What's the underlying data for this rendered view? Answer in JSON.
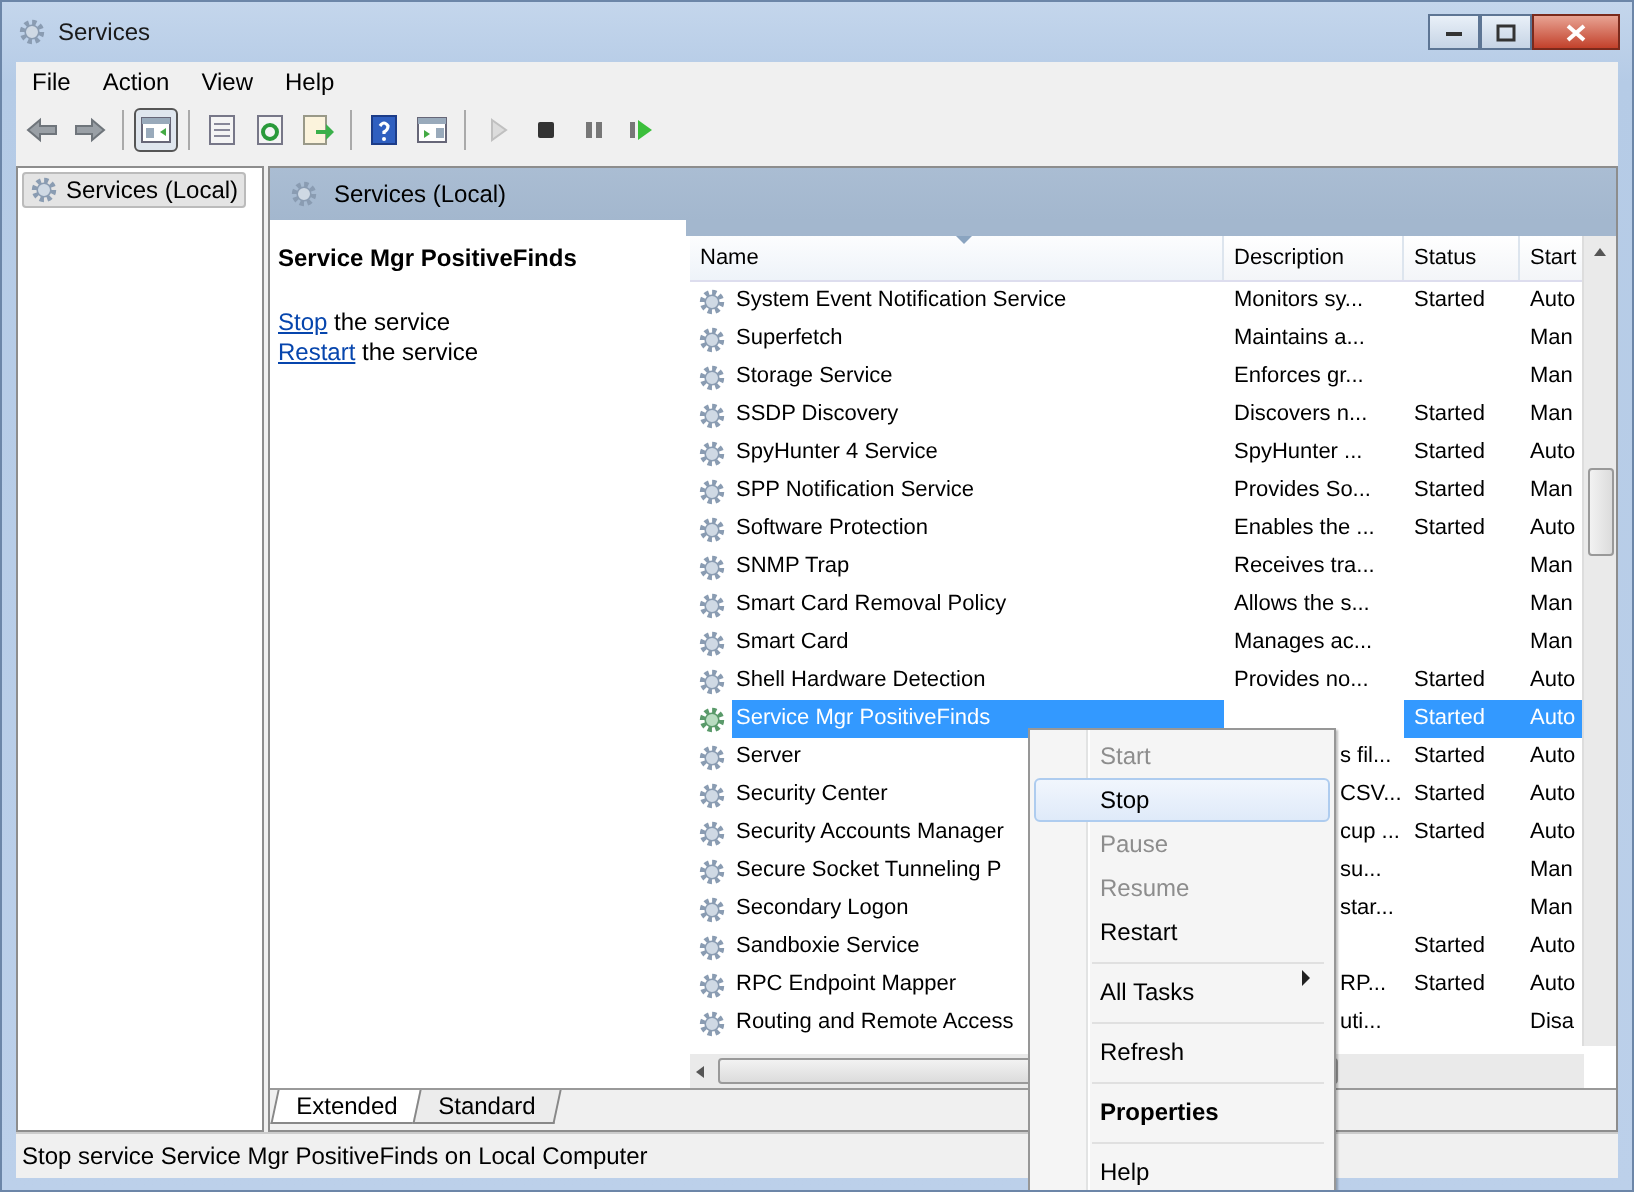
{
  "window": {
    "title": "Services"
  },
  "menu_bar": [
    "File",
    "Action",
    "View",
    "Help"
  ],
  "toolbar": [
    {
      "kind": "back",
      "pressed": false,
      "disabled": false
    },
    {
      "kind": "forward",
      "pressed": false,
      "disabled": false
    },
    {
      "kind": "separator"
    },
    {
      "kind": "console-tree",
      "pressed": true,
      "disabled": false
    },
    {
      "kind": "separator"
    },
    {
      "kind": "properties",
      "pressed": false,
      "disabled": false
    },
    {
      "kind": "refresh",
      "pressed": false,
      "disabled": false
    },
    {
      "kind": "export",
      "pressed": false,
      "disabled": false
    },
    {
      "kind": "separator"
    },
    {
      "kind": "help",
      "pressed": false,
      "disabled": false
    },
    {
      "kind": "action-pane",
      "pressed": false,
      "disabled": false
    },
    {
      "kind": "separator"
    },
    {
      "kind": "start",
      "pressed": false,
      "disabled": true
    },
    {
      "kind": "stop",
      "pressed": false,
      "disabled": false
    },
    {
      "kind": "pause",
      "pressed": false,
      "disabled": false
    },
    {
      "kind": "resume",
      "pressed": false,
      "disabled": false
    }
  ],
  "tree": {
    "items": [
      {
        "label": "Services (Local)",
        "selected": true
      }
    ]
  },
  "pane_header": {
    "title": "Services (Local)"
  },
  "details": {
    "title": "Service Mgr PositiveFinds",
    "actions": [
      {
        "link": "Stop",
        "text": "the service"
      },
      {
        "link": "Restart",
        "text": "the service"
      }
    ]
  },
  "table": {
    "columns": [
      {
        "label": "Name",
        "sorted": true
      },
      {
        "label": "Description",
        "sorted": false
      },
      {
        "label": "Status",
        "sorted": false
      },
      {
        "label": "Start",
        "sorted": false
      }
    ],
    "rows": [
      {
        "name": "System Event Notification Service",
        "description": "Monitors sy...",
        "status": "Started",
        "startup": "Auto",
        "selected": false
      },
      {
        "name": "Superfetch",
        "description": "Maintains a...",
        "status": "",
        "startup": "Man",
        "selected": false
      },
      {
        "name": "Storage Service",
        "description": "Enforces gr...",
        "status": "",
        "startup": "Man",
        "selected": false
      },
      {
        "name": "SSDP Discovery",
        "description": "Discovers n...",
        "status": "Started",
        "startup": "Man",
        "selected": false
      },
      {
        "name": "SpyHunter 4 Service",
        "description": "SpyHunter ...",
        "status": "Started",
        "startup": "Auto",
        "selected": false
      },
      {
        "name": "SPP Notification Service",
        "description": "Provides So...",
        "status": "Started",
        "startup": "Man",
        "selected": false
      },
      {
        "name": "Software Protection",
        "description": "Enables the ...",
        "status": "Started",
        "startup": "Auto",
        "selected": false
      },
      {
        "name": "SNMP Trap",
        "description": "Receives tra...",
        "status": "",
        "startup": "Man",
        "selected": false
      },
      {
        "name": "Smart Card Removal Policy",
        "description": "Allows the s...",
        "status": "",
        "startup": "Man",
        "selected": false
      },
      {
        "name": "Smart Card",
        "description": "Manages ac...",
        "status": "",
        "startup": "Man",
        "selected": false
      },
      {
        "name": "Shell Hardware Detection",
        "description": "Provides no...",
        "status": "Started",
        "startup": "Auto",
        "selected": false
      },
      {
        "name": "Service Mgr PositiveFinds",
        "description": "",
        "status": "Started",
        "startup": "Auto",
        "selected": true
      },
      {
        "name": "Server",
        "description": "s fil...",
        "status": "Started",
        "startup": "Auto",
        "selected": false
      },
      {
        "name": "Security Center",
        "description": "CSV...",
        "status": "Started",
        "startup": "Auto",
        "selected": false
      },
      {
        "name": "Security Accounts Manager",
        "description": "cup ...",
        "status": "Started",
        "startup": "Auto",
        "selected": false
      },
      {
        "name": "Secure Socket Tunneling P",
        "description": "su...",
        "status": "",
        "startup": "Man",
        "selected": false
      },
      {
        "name": "Secondary Logon",
        "description": "star...",
        "status": "",
        "startup": "Man",
        "selected": false
      },
      {
        "name": "Sandboxie Service",
        "description": "",
        "status": "Started",
        "startup": "Auto",
        "selected": false
      },
      {
        "name": "RPC Endpoint Mapper",
        "description": "RP...",
        "status": "Started",
        "startup": "Auto",
        "selected": false
      },
      {
        "name": "Routing and Remote Access",
        "description": "uti...",
        "status": "",
        "startup": "Disa",
        "selected": false
      }
    ]
  },
  "view_tabs": [
    {
      "label": "Extended",
      "selected": true
    },
    {
      "label": "Standard",
      "selected": false
    }
  ],
  "context_menu": [
    {
      "label": "Start",
      "disabled": true,
      "selected": false,
      "default": false,
      "submenu": false,
      "separator_before": false
    },
    {
      "label": "Stop",
      "disabled": false,
      "selected": true,
      "default": false,
      "submenu": false,
      "separator_before": false
    },
    {
      "label": "Pause",
      "disabled": true,
      "selected": false,
      "default": false,
      "submenu": false,
      "separator_before": false
    },
    {
      "label": "Resume",
      "disabled": true,
      "selected": false,
      "default": false,
      "submenu": false,
      "separator_before": false
    },
    {
      "label": "Restart",
      "disabled": false,
      "selected": false,
      "default": false,
      "submenu": false,
      "separator_before": false
    },
    {
      "label": "All Tasks",
      "disabled": false,
      "selected": false,
      "default": false,
      "submenu": true,
      "separator_before": true
    },
    {
      "label": "Refresh",
      "disabled": false,
      "selected": false,
      "default": false,
      "submenu": false,
      "separator_before": true
    },
    {
      "label": "Properties",
      "disabled": false,
      "selected": false,
      "default": true,
      "submenu": false,
      "separator_before": true
    },
    {
      "label": "Help",
      "disabled": false,
      "selected": false,
      "default": false,
      "submenu": false,
      "separator_before": true
    }
  ],
  "status_bar": {
    "text": "Stop service Service Mgr PositiveFinds on Local Computer"
  }
}
